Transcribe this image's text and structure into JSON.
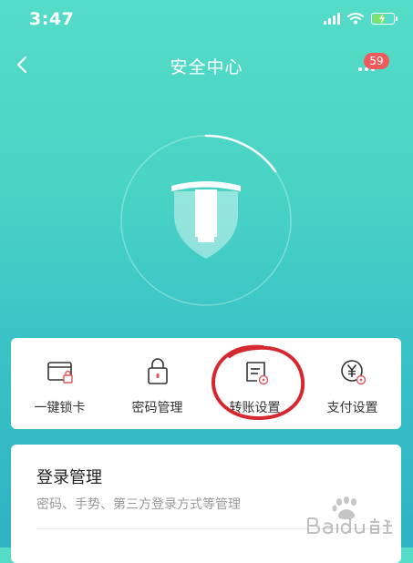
{
  "status_bar": {
    "time": "3:47",
    "battery_level": 0.6
  },
  "nav": {
    "title": "安全中心",
    "badge_count": "59"
  },
  "quick_actions": [
    {
      "label": "一键锁卡",
      "icon": "card-lock-icon"
    },
    {
      "label": "密码管理",
      "icon": "padlock-icon"
    },
    {
      "label": "转账设置",
      "icon": "transfer-settings-icon",
      "highlighted": true
    },
    {
      "label": "支付设置",
      "icon": "yen-payment-icon"
    }
  ],
  "login_section": {
    "title": "登录管理",
    "description": "密码、手势、第三方登录方式等管理"
  },
  "colors": {
    "gradient_top": "#55dcc7",
    "gradient_bottom": "#2fb2c4",
    "highlight_circle": "#d6282f",
    "badge": "#f05a5a"
  },
  "watermark": {
    "text": "Baidu 经验"
  }
}
